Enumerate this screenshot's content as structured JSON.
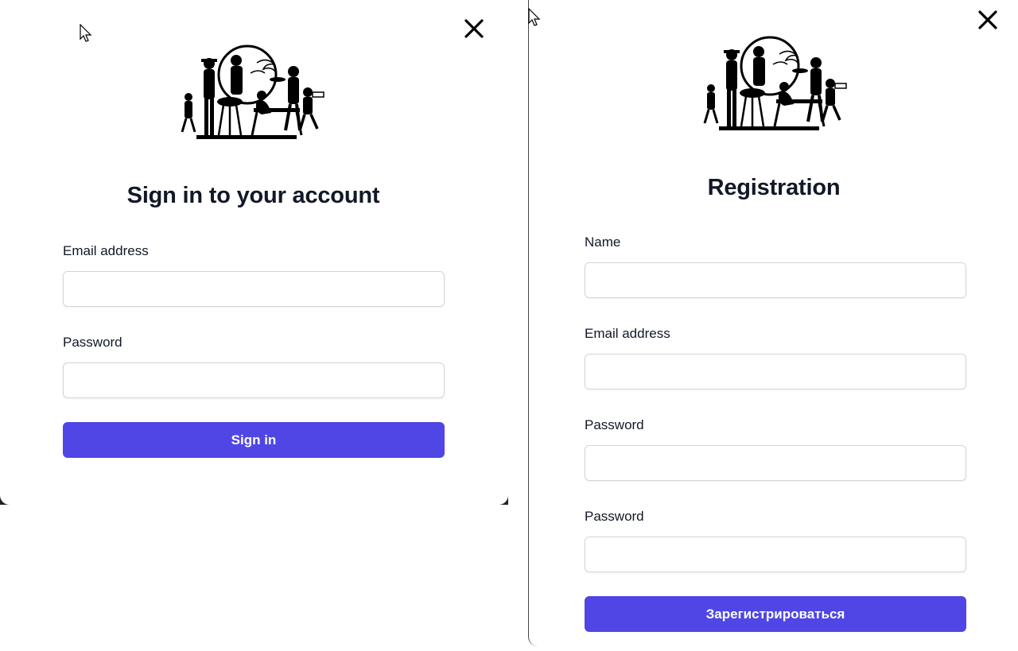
{
  "login_modal": {
    "title": "Sign in to your account",
    "email_label": "Email address",
    "email_value": "",
    "password_label": "Password",
    "password_value": "",
    "submit_label": "Sign in",
    "close_icon": "close-icon",
    "logo": "bbq-family-logo"
  },
  "registration_modal": {
    "title": "Registration",
    "name_label": "Name",
    "name_value": "",
    "email_label": "Email address",
    "email_value": "",
    "password_label": "Password",
    "password_value": "",
    "password_confirm_label": "Password",
    "password_confirm_value": "",
    "submit_label": "Зарегистрироваться",
    "close_icon": "close-icon",
    "logo": "bbq-family-logo"
  },
  "colors": {
    "accent": "#4f46e5",
    "title_text": "#111827",
    "input_border": "#d1d5db"
  }
}
